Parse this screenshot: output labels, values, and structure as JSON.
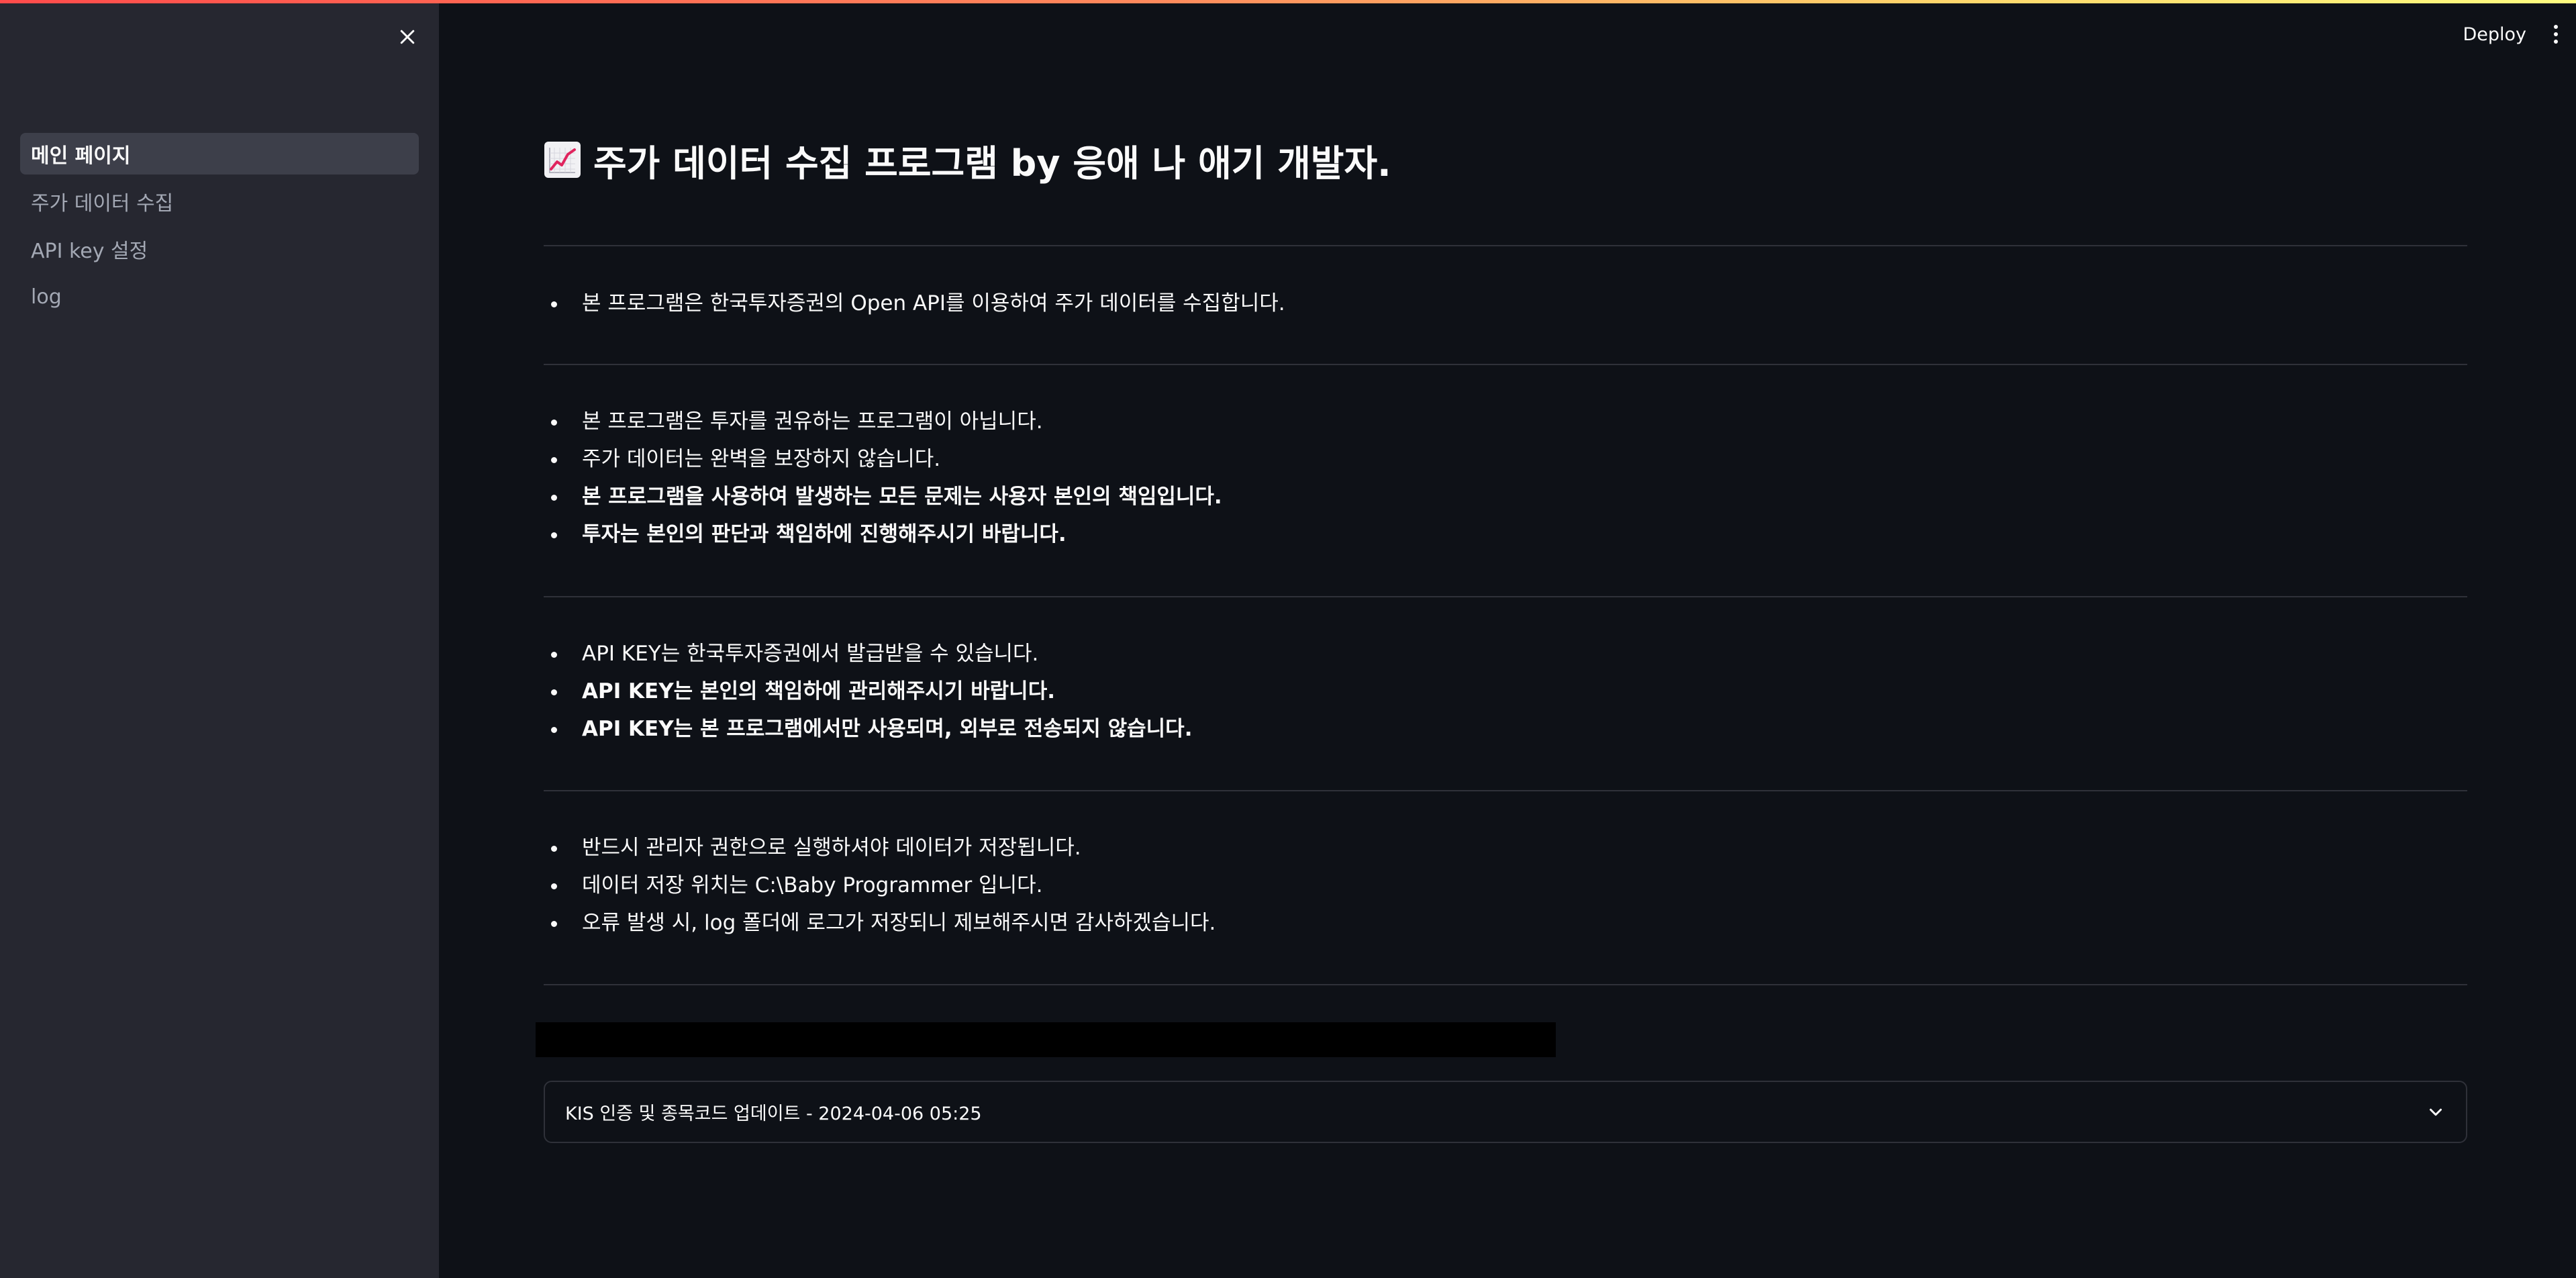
{
  "header": {
    "deploy_label": "Deploy"
  },
  "sidebar": {
    "items": [
      {
        "label": "메인 페이지",
        "active": true
      },
      {
        "label": "주가 데이터 수집",
        "active": false
      },
      {
        "label": "API key 설정",
        "active": false
      },
      {
        "label": "log",
        "active": false
      }
    ]
  },
  "main": {
    "title_icon": "chart-increasing-icon",
    "title": "주가 데이터 수집 프로그램 by 응애 나 애기 개발자.",
    "sections": [
      {
        "items": [
          {
            "text": "본 프로그램은 한국투자증권의 Open API를 이용하여 주가 데이터를 수집합니다.",
            "bold": false
          }
        ]
      },
      {
        "items": [
          {
            "text": "본 프로그램은 투자를 권유하는 프로그램이 아닙니다.",
            "bold": false
          },
          {
            "text": "주가 데이터는 완벽을 보장하지 않습니다.",
            "bold": false
          },
          {
            "text": "본 프로그램을 사용하여 발생하는 모든 문제는 사용자 본인의 책임입니다.",
            "bold": true
          },
          {
            "text": "투자는 본인의 판단과 책임하에 진행해주시기 바랍니다.",
            "bold": true
          }
        ]
      },
      {
        "items": [
          {
            "text": "API KEY는 한국투자증권에서 발급받을 수 있습니다.",
            "bold": false
          },
          {
            "text": "API KEY는 본인의 책임하에 관리해주시기 바랍니다.",
            "bold": true
          },
          {
            "text": "API KEY는 본 프로그램에서만 사용되며, 외부로 전송되지 않습니다.",
            "bold": true
          }
        ]
      },
      {
        "items": [
          {
            "text": "반드시 관리자 권한으로 실행하셔야 데이터가 저장됩니다.",
            "bold": false
          },
          {
            "text": "데이터 저장 위치는 C:\\Baby Programmer 입니다.",
            "bold": false
          },
          {
            "text": "오류 발생 시, log 폴더에 로그가 저장되니 제보해주시면 감사하겠습니다.",
            "bold": false
          }
        ]
      }
    ],
    "expander_label": "KIS 인증 및 종목코드 업데이트 - 2024-04-06 05:25"
  },
  "colors": {
    "background": "#0e1117",
    "sidebar": "#262730",
    "active_item": "#3d3f4a",
    "divider": "#2f3139",
    "text": "#fafafa",
    "muted_text": "#a3a8b4"
  }
}
